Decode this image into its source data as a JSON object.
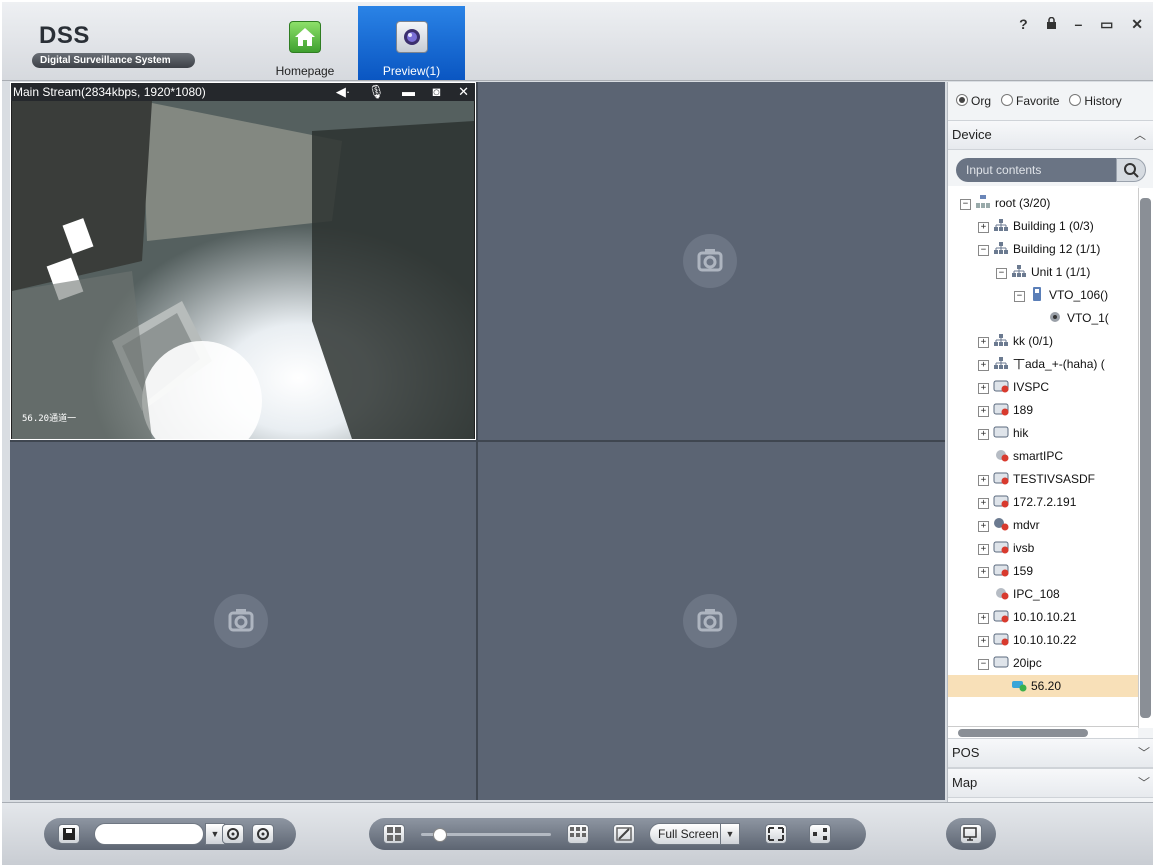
{
  "app": {
    "title": "DSS",
    "subtitle": "Digital Surveillance System"
  },
  "tabs": [
    {
      "label": "Homepage",
      "icon": "home-icon"
    },
    {
      "label": "Preview(1)",
      "icon": "camera-icon",
      "active": true
    }
  ],
  "window_controls": {
    "help": "?",
    "lock": "🔒",
    "minimize": "–",
    "maximize": "▭",
    "close": "✕"
  },
  "video": {
    "stream_info": "Main Stream(2834kbps, 1920*1080)",
    "osd_left": "56.20通道一",
    "tools": [
      "audio-icon",
      "mic-icon",
      "record-icon",
      "snapshot-icon",
      "close-icon"
    ]
  },
  "panel": {
    "radio_options": [
      {
        "label": "Org",
        "checked": true
      },
      {
        "label": "Favorite",
        "checked": false
      },
      {
        "label": "History",
        "checked": false
      }
    ],
    "device_label": "Device",
    "search_placeholder": "Input contents",
    "tree": [
      {
        "label": "root (3/20)",
        "level": 0,
        "expand": "−",
        "icon": "org-icon"
      },
      {
        "label": "Building 1 (0/3)",
        "level": 1,
        "expand": "+",
        "icon": "network-icon"
      },
      {
        "label": "Building 12 (1/1)",
        "level": 1,
        "expand": "−",
        "icon": "network-icon"
      },
      {
        "label": "Unit 1 (1/1)",
        "level": 2,
        "expand": "−",
        "icon": "network-icon"
      },
      {
        "label": "VTO_106()",
        "level": 3,
        "expand": "−",
        "icon": "vto-icon"
      },
      {
        "label": "VTO_1(",
        "level": 4,
        "expand": "",
        "icon": "camera-icon"
      },
      {
        "label": "kk (0/1)",
        "level": 1,
        "expand": "+",
        "icon": "network-icon"
      },
      {
        "label": "丅ada_+-(haha) (",
        "level": 1,
        "expand": "+",
        "icon": "network-icon"
      },
      {
        "label": "IVSPC",
        "level": 1,
        "expand": "+",
        "icon": "dvr-offline-icon"
      },
      {
        "label": "189",
        "level": 1,
        "expand": "+",
        "icon": "dvr-offline-icon"
      },
      {
        "label": "hik",
        "level": 1,
        "expand": "+",
        "icon": "dvr-icon"
      },
      {
        "label": "smartIPC",
        "level": 1,
        "expand": "",
        "icon": "ipc-offline-icon"
      },
      {
        "label": "TESTIVSASDF",
        "level": 1,
        "expand": "+",
        "icon": "dvr-offline-icon"
      },
      {
        "label": "172.7.2.191",
        "level": 1,
        "expand": "+",
        "icon": "dvr-offline-icon"
      },
      {
        "label": "mdvr",
        "level": 1,
        "expand": "+",
        "icon": "mdvr-offline-icon"
      },
      {
        "label": "ivsb",
        "level": 1,
        "expand": "+",
        "icon": "dvr-offline-icon"
      },
      {
        "label": "159",
        "level": 1,
        "expand": "+",
        "icon": "dvr-offline-icon"
      },
      {
        "label": "IPC_108",
        "level": 1,
        "expand": "",
        "icon": "ipc-offline-icon"
      },
      {
        "label": "10.10.10.21",
        "level": 1,
        "expand": "+",
        "icon": "dvr-offline-icon"
      },
      {
        "label": "10.10.10.22",
        "level": 1,
        "expand": "+",
        "icon": "dvr-offline-icon"
      },
      {
        "label": "20ipc",
        "level": 1,
        "expand": "−",
        "icon": "dvr-icon"
      },
      {
        "label": "56.20",
        "level": 2,
        "expand": "",
        "icon": "ipc-online-icon",
        "selected": true
      }
    ],
    "pos_label": "POS",
    "map_label": "Map"
  },
  "toolbar": {
    "fullscreen_label": "Full Screen",
    "stream_select_value": ""
  },
  "colors": {
    "active_tab": "#0a56c2",
    "grid_bg": "#5b6473",
    "selected_row": "#f8e0b8"
  }
}
